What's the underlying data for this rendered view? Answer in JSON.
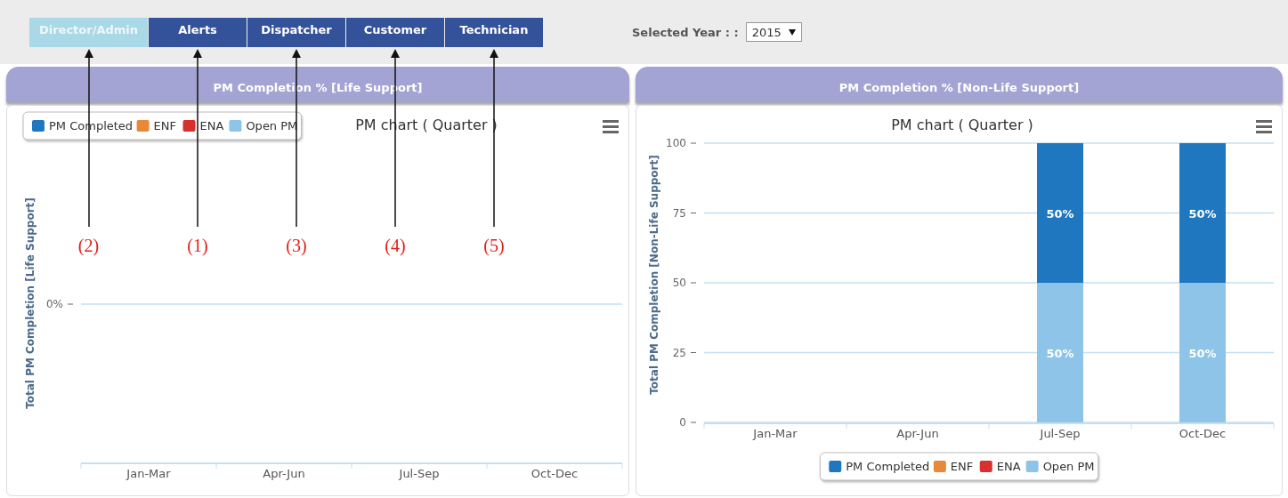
{
  "tabs": [
    {
      "label": "Director/Admin",
      "selected": true,
      "callout": "(2)"
    },
    {
      "label": "Alerts",
      "selected": false,
      "callout": "(1)"
    },
    {
      "label": "Dispatcher",
      "selected": false,
      "callout": "(3)"
    },
    {
      "label": "Customer",
      "selected": false,
      "callout": "(4)"
    },
    {
      "label": "Technician",
      "selected": false,
      "callout": "(5)"
    }
  ],
  "year_filter": {
    "label": "Selected Year : :",
    "value": "2015"
  },
  "panels": [
    {
      "title": "PM Completion % [Life Support]",
      "y_tick_label": "0%",
      "chart_data": {
        "type": "other",
        "title": "PM chart ( Quarter )",
        "ylabel": "Total PM Completion [Life Support]",
        "categories": [
          "Jan-Mar",
          "Apr-Jun",
          "Jul-Sep",
          "Oct-Dec"
        ],
        "legend": "top-left",
        "series": [
          {
            "name": "PM Completed",
            "color": "#1f77c0",
            "values": [
              null,
              null,
              null,
              null
            ]
          },
          {
            "name": "ENF",
            "color": "#e8893a",
            "values": [
              null,
              null,
              null,
              null
            ]
          },
          {
            "name": "ENA",
            "color": "#d6312c",
            "values": [
              null,
              null,
              null,
              null
            ]
          },
          {
            "name": "Open PM",
            "color": "#8ec4e8",
            "values": [
              null,
              null,
              null,
              null
            ]
          }
        ]
      }
    },
    {
      "title": "PM Completion % [Non-Life Support]",
      "chart_data": {
        "type": "bar",
        "title": "PM chart ( Quarter )",
        "ylabel": "Total PM Completion [Non-Life Support]",
        "categories": [
          "Jan-Mar",
          "Apr-Jun",
          "Jul-Sep",
          "Oct-Dec"
        ],
        "stacked": true,
        "grid": true,
        "legend": "bottom",
        "ylim": [
          0,
          100
        ],
        "yticks": [
          0,
          25,
          50,
          75,
          100
        ],
        "series": [
          {
            "name": "PM Completed",
            "color": "#1f77c0",
            "values": [
              null,
              null,
              50,
              50
            ],
            "value_labels": [
              null,
              null,
              "50%",
              "50%"
            ]
          },
          {
            "name": "ENF",
            "color": "#e8893a",
            "values": [
              null,
              null,
              null,
              null
            ]
          },
          {
            "name": "ENA",
            "color": "#d6312c",
            "values": [
              null,
              null,
              null,
              null
            ]
          },
          {
            "name": "Open PM",
            "color": "#8ec4e8",
            "values": [
              null,
              null,
              50,
              50
            ],
            "value_labels": [
              null,
              null,
              "50%",
              "50%"
            ]
          }
        ]
      }
    }
  ]
}
